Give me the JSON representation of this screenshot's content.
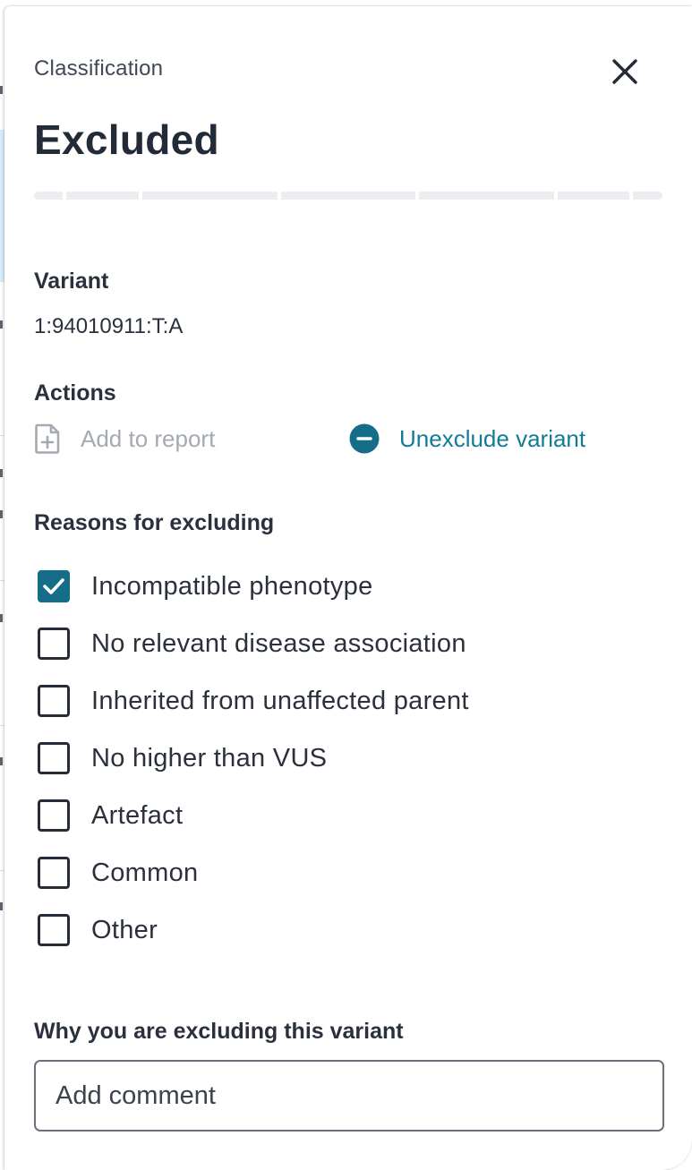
{
  "panel": {
    "eyebrow": "Classification",
    "title": "Excluded",
    "progress_segments": 8
  },
  "variant": {
    "heading": "Variant",
    "value": "1:94010911:T:A"
  },
  "actions": {
    "heading": "Actions",
    "add_to_report": "Add to report",
    "unexclude": "Unexclude variant"
  },
  "reasons": {
    "heading": "Reasons for excluding",
    "items": [
      {
        "label": "Incompatible phenotype",
        "checked": true
      },
      {
        "label": "No relevant disease association",
        "checked": false
      },
      {
        "label": "Inherited from unaffected parent",
        "checked": false
      },
      {
        "label": "No higher than VUS",
        "checked": false
      },
      {
        "label": "Artefact",
        "checked": false
      },
      {
        "label": "Common",
        "checked": false
      },
      {
        "label": "Other",
        "checked": false
      }
    ]
  },
  "comment": {
    "heading": "Why you are excluding this variant",
    "placeholder": "Add comment",
    "value": ""
  },
  "colors": {
    "accent": "#146e8a",
    "link": "#127c98",
    "disabled": "#a4aab2",
    "text": "#222b38"
  },
  "icons": {
    "close": "close-icon",
    "add_report": "file-plus-icon",
    "unexclude": "minus-circle-icon",
    "checkbox_checked": "checkmark-icon"
  }
}
